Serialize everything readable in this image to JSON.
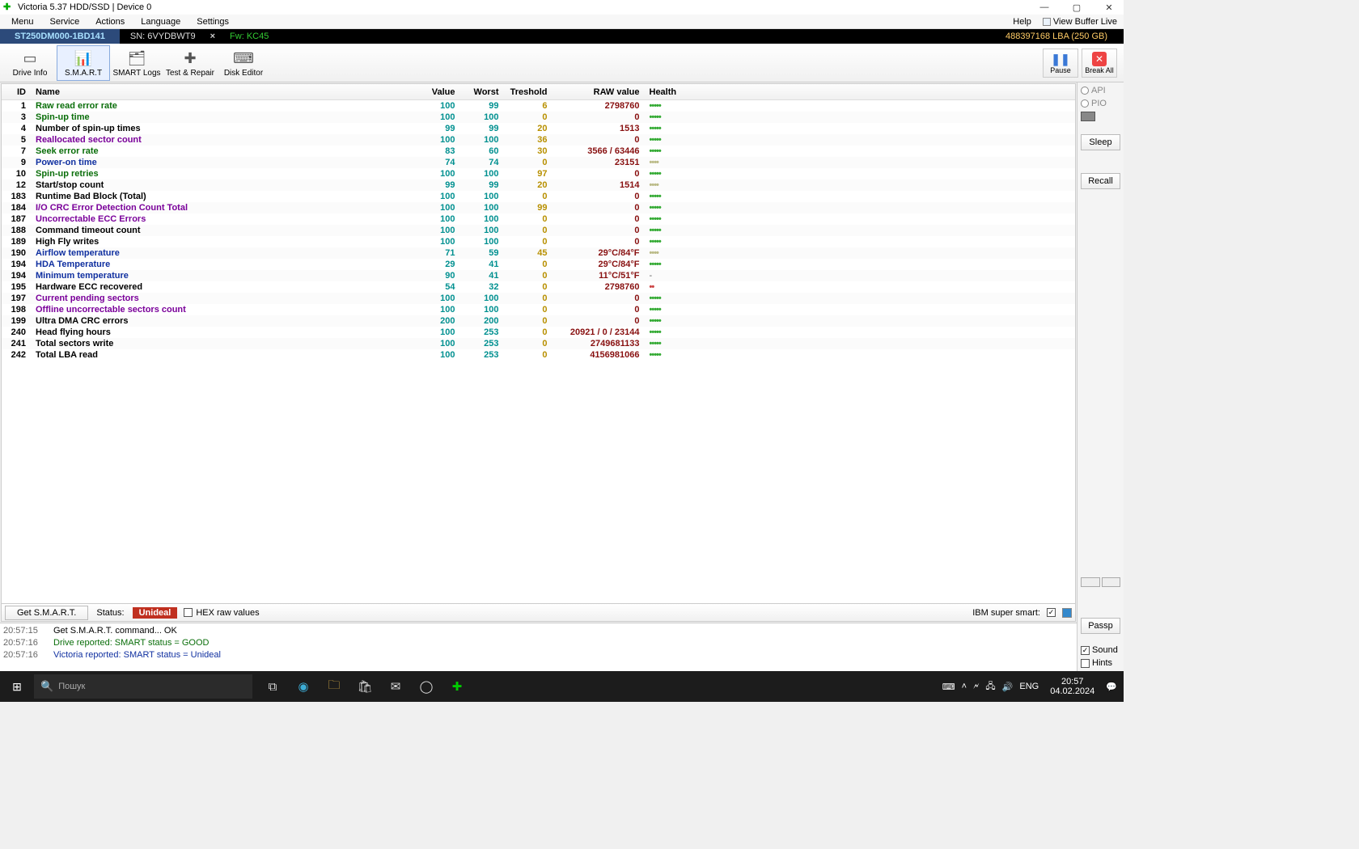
{
  "title": "Victoria 5.37 HDD/SSD | Device 0",
  "menu": [
    "Menu",
    "Service",
    "Actions",
    "Language",
    "Settings"
  ],
  "menu_right": "Help",
  "view_buffer": "View Buffer Live",
  "infobar": {
    "drive": "ST250DM000-1BD141",
    "sn_label": "SN:",
    "sn": "6VYDBWT9",
    "fw_label": "Fw:",
    "fw": "KC45",
    "lba": "488397168 LBA (250 GB)"
  },
  "toolbar": [
    {
      "label": "Drive Info",
      "icon": "▭"
    },
    {
      "label": "S.M.A.R.T",
      "icon": "📊",
      "active": true
    },
    {
      "label": "SMART Logs",
      "icon": "🗂"
    },
    {
      "label": "Test & Repair",
      "icon": "✚"
    },
    {
      "label": "Disk Editor",
      "icon": "⌨"
    }
  ],
  "toolbar_right": [
    {
      "label": "Pause",
      "icon": "❚❚",
      "cls": "pause"
    },
    {
      "label": "Break All",
      "icon": "✕",
      "cls": "break"
    }
  ],
  "columns": {
    "id": "ID",
    "name": "Name",
    "value": "Value",
    "worst": "Worst",
    "threshold": "Treshold",
    "raw": "RAW value",
    "health": "Health"
  },
  "smart": [
    {
      "id": 1,
      "name": "Raw read error rate",
      "ncls": "n-green",
      "val": 100,
      "worst": 99,
      "thr": 6,
      "raw": "2798760",
      "h": "dots5"
    },
    {
      "id": 3,
      "name": "Spin-up time",
      "ncls": "n-green",
      "val": 100,
      "worst": 100,
      "thr": 0,
      "raw": "0",
      "h": "dots5"
    },
    {
      "id": 4,
      "name": "Number of spin-up times",
      "ncls": "n-black",
      "val": 99,
      "worst": 99,
      "thr": 20,
      "raw": "1513",
      "h": "dots5"
    },
    {
      "id": 5,
      "name": "Reallocated sector count",
      "ncls": "n-purple",
      "val": 100,
      "worst": 100,
      "thr": 36,
      "raw": "0",
      "h": "dots5"
    },
    {
      "id": 7,
      "name": "Seek error rate",
      "ncls": "n-green",
      "val": 83,
      "worst": 60,
      "thr": 30,
      "raw": "3566 / 63446",
      "h": "dots5"
    },
    {
      "id": 9,
      "name": "Power-on time",
      "ncls": "n-blue",
      "val": 74,
      "worst": 74,
      "thr": 0,
      "raw": "23151",
      "h": "dots4"
    },
    {
      "id": 10,
      "name": "Spin-up retries",
      "ncls": "n-green",
      "val": 100,
      "worst": 100,
      "thr": 97,
      "raw": "0",
      "h": "dots5"
    },
    {
      "id": 12,
      "name": "Start/stop count",
      "ncls": "n-black",
      "val": 99,
      "worst": 99,
      "thr": 20,
      "raw": "1514",
      "h": "dots4"
    },
    {
      "id": 183,
      "name": "Runtime Bad Block (Total)",
      "ncls": "n-black",
      "val": 100,
      "worst": 100,
      "thr": 0,
      "raw": "0",
      "h": "dots5"
    },
    {
      "id": 184,
      "name": "I/O CRC Error Detection Count Total",
      "ncls": "n-purple",
      "val": 100,
      "worst": 100,
      "thr": 99,
      "raw": "0",
      "h": "dots5"
    },
    {
      "id": 187,
      "name": "Uncorrectable ECC Errors",
      "ncls": "n-purple",
      "val": 100,
      "worst": 100,
      "thr": 0,
      "raw": "0",
      "h": "dots5"
    },
    {
      "id": 188,
      "name": "Command timeout count",
      "ncls": "n-black",
      "val": 100,
      "worst": 100,
      "thr": 0,
      "raw": "0",
      "h": "dots5"
    },
    {
      "id": 189,
      "name": "High Fly writes",
      "ncls": "n-black",
      "val": 100,
      "worst": 100,
      "thr": 0,
      "raw": "0",
      "h": "dots5"
    },
    {
      "id": 190,
      "name": "Airflow temperature",
      "ncls": "n-blue",
      "val": 71,
      "worst": 59,
      "thr": 45,
      "raw": "29°C/84°F",
      "h": "dots4"
    },
    {
      "id": 194,
      "name": "HDA Temperature",
      "ncls": "n-blue",
      "val": 29,
      "worst": 41,
      "thr": 0,
      "raw": "29°C/84°F",
      "h": "dots5"
    },
    {
      "id": 194,
      "name": "Minimum temperature",
      "ncls": "n-blue",
      "val": 90,
      "worst": 41,
      "thr": 0,
      "raw": "11°C/51°F",
      "h": "dash"
    },
    {
      "id": 195,
      "name": "Hardware ECC recovered",
      "ncls": "n-black",
      "val": 54,
      "worst": 32,
      "thr": 0,
      "raw": "2798760",
      "h": "dots2"
    },
    {
      "id": 197,
      "name": "Current pending sectors",
      "ncls": "n-purple",
      "val": 100,
      "worst": 100,
      "thr": 0,
      "raw": "0",
      "h": "dots5"
    },
    {
      "id": 198,
      "name": "Offline uncorrectable sectors count",
      "ncls": "n-purple",
      "val": 100,
      "worst": 100,
      "thr": 0,
      "raw": "0",
      "h": "dots5"
    },
    {
      "id": 199,
      "name": "Ultra DMA CRC errors",
      "ncls": "n-black",
      "val": 200,
      "worst": 200,
      "thr": 0,
      "raw": "0",
      "h": "dots5"
    },
    {
      "id": 240,
      "name": "Head flying hours",
      "ncls": "n-black",
      "val": 100,
      "worst": 253,
      "thr": 0,
      "raw": "20921 / 0 / 23144",
      "h": "dots5"
    },
    {
      "id": 241,
      "name": "Total sectors write",
      "ncls": "n-black",
      "val": 100,
      "worst": 253,
      "thr": 0,
      "raw": "2749681133",
      "h": "dots5"
    },
    {
      "id": 242,
      "name": "Total LBA read",
      "ncls": "n-black",
      "val": 100,
      "worst": 253,
      "thr": 0,
      "raw": "4156981066",
      "h": "dots5"
    }
  ],
  "bottom": {
    "get": "Get S.M.A.R.T.",
    "status_lbl": "Status:",
    "status_val": "Unideal",
    "hex": "HEX raw values",
    "ibm": "IBM super smart:"
  },
  "right": {
    "api": "API",
    "pio": "PIO",
    "sleep": "Sleep",
    "recall": "Recall",
    "passp": "Passp",
    "sound": "Sound",
    "hints": "Hints"
  },
  "log": [
    {
      "t": "20:57:15",
      "msg": "Get S.M.A.R.T. command... OK",
      "cls": "msg-black"
    },
    {
      "t": "20:57:16",
      "msg": "Drive reported: SMART status = GOOD",
      "cls": "msg-ok"
    },
    {
      "t": "20:57:16",
      "msg": "Victoria reported: SMART status = Unideal",
      "cls": "msg-info"
    }
  ],
  "taskbar": {
    "search": "Пошук",
    "lang": "ENG",
    "time": "20:57",
    "date": "04.02.2024"
  }
}
